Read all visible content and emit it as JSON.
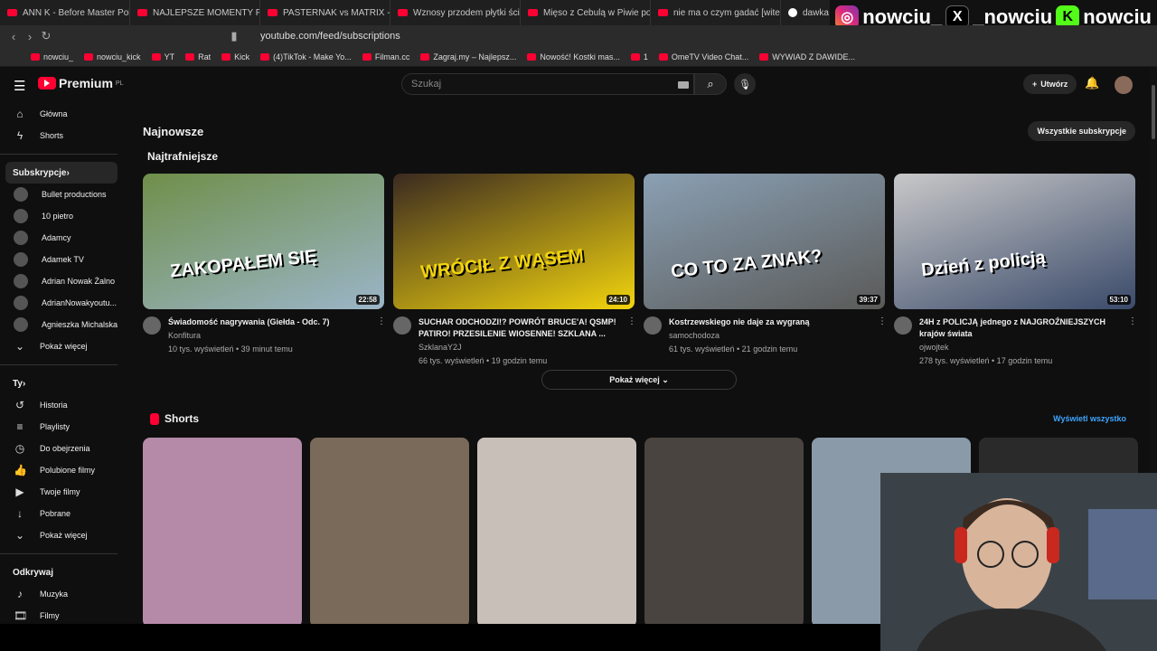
{
  "browser": {
    "tabs": [
      {
        "title": "ANN K - Before Master Poland",
        "icon": "yt"
      },
      {
        "title": "NAJLEPSZE MOMENTY POLSKI",
        "icon": "yt"
      },
      {
        "title": "PASTERNAK vs MATRIX - CAŁA",
        "icon": "yt"
      },
      {
        "title": "Wznosy przodem płytki ściennie",
        "icon": "yt"
      },
      {
        "title": "Mięso z Cebulą w Piwie po Tex",
        "icon": "yt"
      },
      {
        "title": "nie ma o czym gadać [witek ×",
        "icon": "yt"
      },
      {
        "title": "dawka smiertelna melaton",
        "icon": "google"
      }
    ],
    "url": "youtube.com/feed/subscriptions",
    "bookmarks": [
      "nowciu_",
      "nowciu_kick",
      "YT",
      "Rat",
      "Kick",
      "(4)TikTok - Make Yo...",
      "Filman.cc",
      "Zagraj.my – Najlepsz...",
      "Nowość! Kostki mas...",
      "1",
      "OmeTV Video Chat...",
      "WYWIAD Z DAWIDE..."
    ]
  },
  "overlay": {
    "instagram": "nowciu_",
    "x": "_nowciu",
    "kick": "nowciu"
  },
  "header": {
    "logo": "Premium",
    "region": "PL",
    "search_placeholder": "Szukaj",
    "create": "Utwórz"
  },
  "sidebar": {
    "main": [
      {
        "label": "Główna",
        "icon": "home-icon"
      },
      {
        "label": "Shorts",
        "icon": "shorts-icon"
      }
    ],
    "subs_title": "Subskrypcje",
    "subs": [
      "Bullet productions",
      "10 pietro",
      "Adamcy",
      "Adamek TV",
      "Adrian Nowak Żalno",
      "AdrianNowakyoutu...",
      "Agnieszka Michalska"
    ],
    "subs_more": "Pokaż więcej",
    "you_title": "Ty",
    "you": [
      {
        "label": "Historia",
        "icon": "history-icon"
      },
      {
        "label": "Playlisty",
        "icon": "playlist-icon"
      },
      {
        "label": "Do obejrzenia",
        "icon": "clock-icon"
      },
      {
        "label": "Polubione filmy",
        "icon": "like-icon"
      },
      {
        "label": "Twoje filmy",
        "icon": "video-icon"
      },
      {
        "label": "Pobrane",
        "icon": "download-icon"
      }
    ],
    "you_more": "Pokaż więcej",
    "explore_title": "Odkrywaj",
    "explore": [
      {
        "label": "Muzyka",
        "icon": "music-icon"
      },
      {
        "label": "Filmy",
        "icon": "film-icon"
      }
    ]
  },
  "main": {
    "title": "Najnowsze",
    "all_subs": "Wszystkie subskrypcje",
    "section": "Najtrafniejsze",
    "videos": [
      {
        "title": "Świadomość nagrywania (Giełda - Odc. 7)",
        "channel": "Konfitura",
        "stats": "10 tys. wyświetleń • 39 minut temu",
        "duration": "22:58",
        "overlay": "ZAKOPAŁEM SIĘ",
        "color1": "#6f8f4a",
        "color2": "#9bb5c8"
      },
      {
        "title": "SUCHAR ODCHODZI!? POWRÓT BRUCE'A! QSMP! PATIRO! PRZESILENIE WIOSENNE! SZKLANA ...",
        "channel": "SzklanaY2J",
        "stats": "66 tys. wyświetleń • 19 godzin temu",
        "duration": "24:10",
        "overlay": "WRÓCIŁ Z WĄSEM",
        "color1": "#3a2a20",
        "color2": "#f2d40e"
      },
      {
        "title": "Kostrzewskiego nie daje za wygraną",
        "channel": "samochodoza",
        "stats": "61 tys. wyświetleń • 21 godzin temu",
        "duration": "39:37",
        "overlay": "CO TO ZA ZNAK?",
        "color1": "#8aa0b4",
        "color2": "#5a5a58"
      },
      {
        "title": "24H z POLICJĄ jednego z NAJGROŹNIEJSZYCH krajów świata",
        "channel": "ojwojtek",
        "stats": "278 tys. wyświetleń • 17 godzin temu",
        "duration": "53:10",
        "overlay": "Dzień z policją",
        "color1": "#c8c8c8",
        "color2": "#3a4a6a"
      }
    ],
    "show_more": "Pokaż więcej",
    "shorts_title": "Shorts",
    "shorts_all": "Wyświetl wszystko",
    "shorts": [
      {
        "color": "#b58aa8"
      },
      {
        "color": "#7a6a5a"
      },
      {
        "color": "#c8c0b8"
      },
      {
        "color": "#4a4440"
      },
      {
        "color": "#8a9aa8"
      },
      {
        "color": "#2a2a2a"
      }
    ]
  }
}
